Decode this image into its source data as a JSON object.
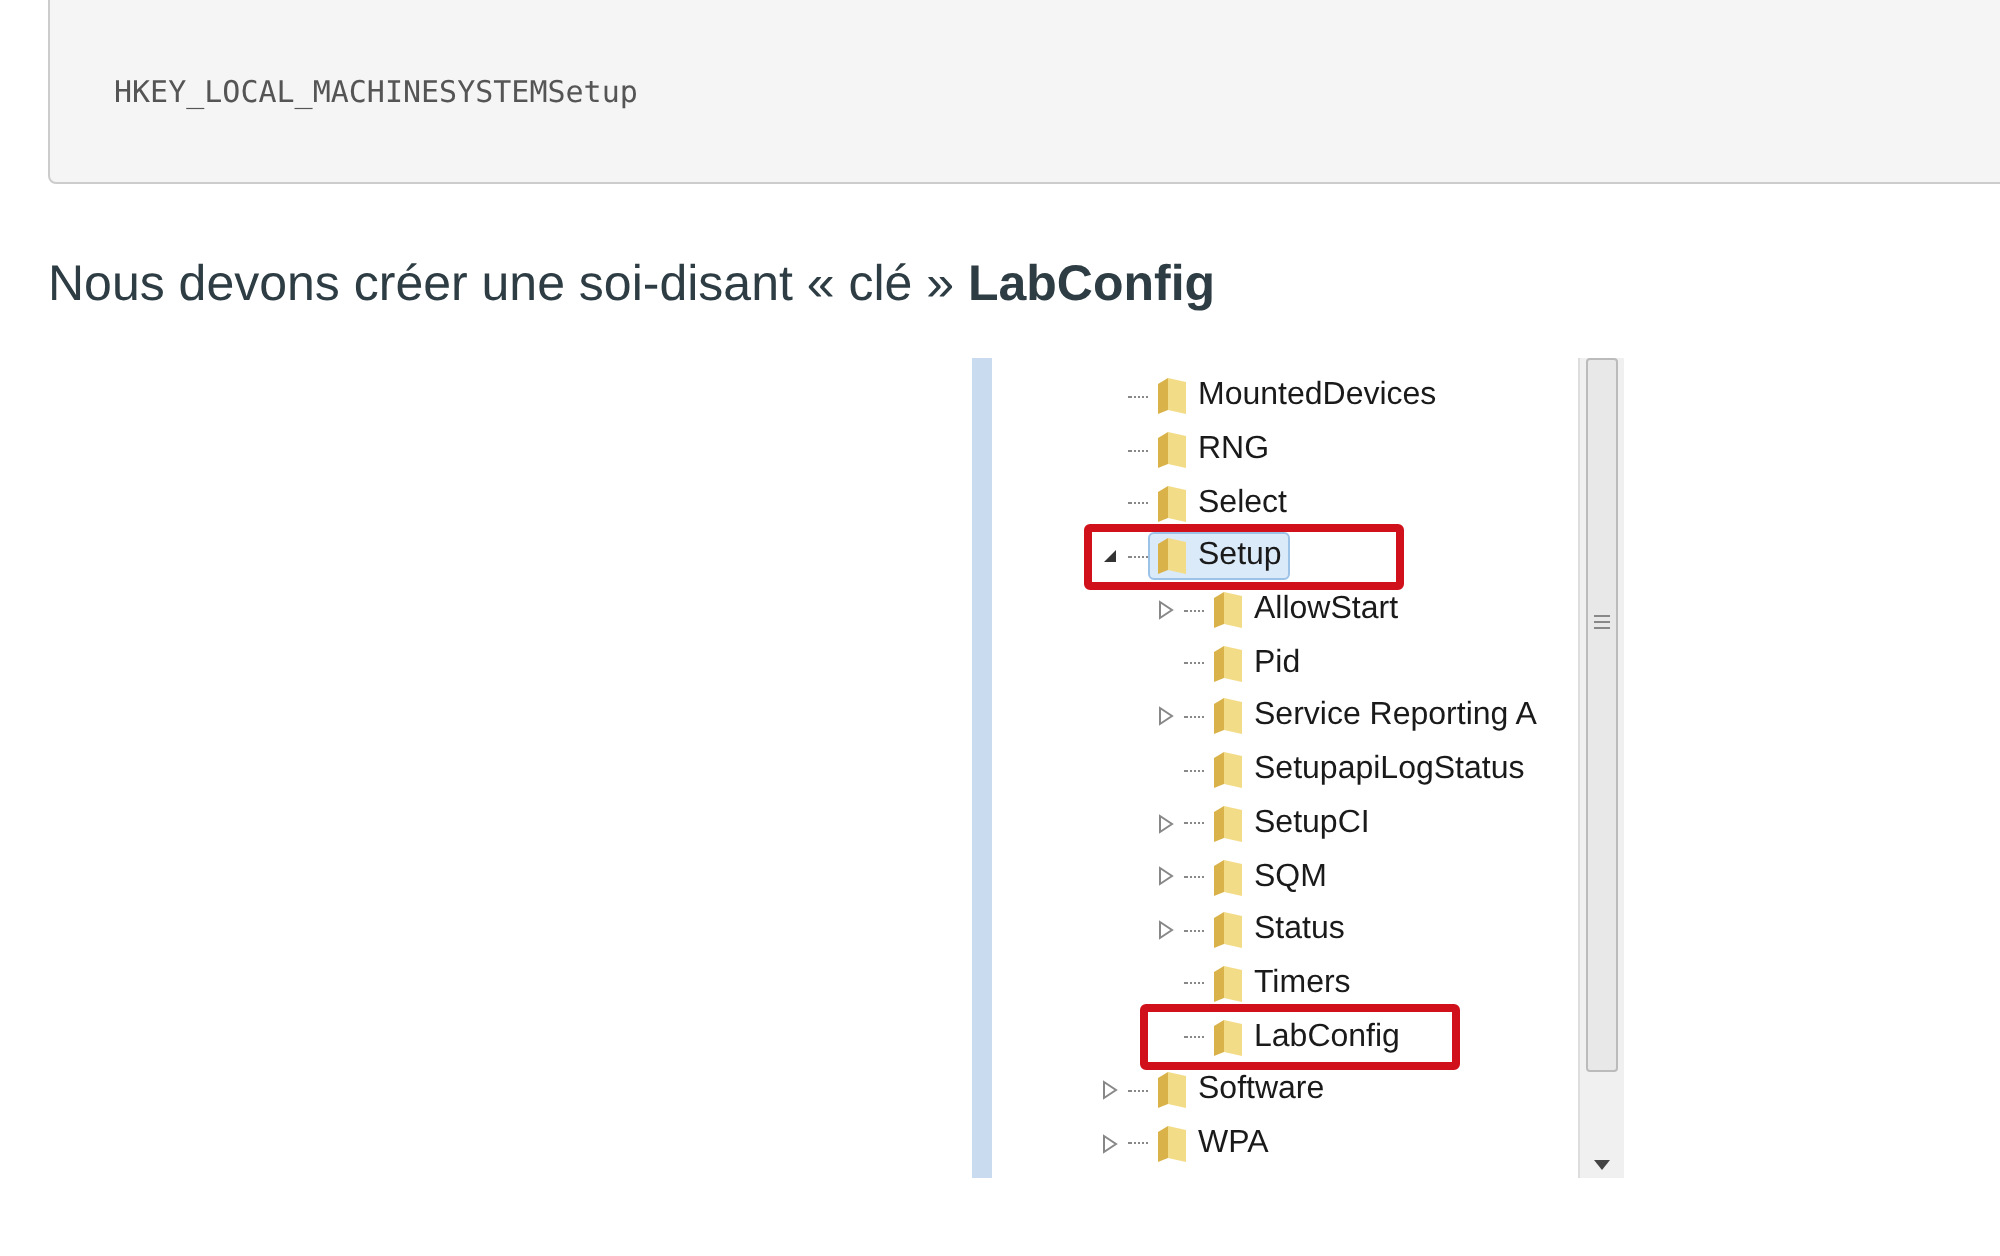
{
  "code_block": {
    "text": "HKEY_LOCAL_MACHINESYSTEMSetup"
  },
  "paragraph": {
    "text": "Nous devons créer une soi-disant « clé » **LabConfig**"
  },
  "registry_tree": {
    "items": [
      {
        "label": "MountedDevices",
        "selected": false,
        "highlighted": false
      },
      {
        "label": "RNG",
        "selected": false,
        "highlighted": false
      },
      {
        "label": "Select",
        "selected": false,
        "highlighted": false
      },
      {
        "label": "Setup",
        "expanded": true,
        "selected": true,
        "highlighted": true,
        "children": [
          {
            "label": "AllowStart",
            "expanded": false,
            "selected": false,
            "highlighted": false
          },
          {
            "label": "Pid",
            "selected": false,
            "highlighted": false
          },
          {
            "label": "Service Reporting A",
            "expanded": false,
            "selected": false,
            "highlighted": false
          },
          {
            "label": "SetupapiLogStatus",
            "selected": false,
            "highlighted": false
          },
          {
            "label": "SetupCI",
            "expanded": false,
            "selected": false,
            "highlighted": false
          },
          {
            "label": "SQM",
            "expanded": false,
            "selected": false,
            "highlighted": false
          },
          {
            "label": "Status",
            "expanded": false,
            "selected": false,
            "highlighted": false
          },
          {
            "label": "Timers",
            "selected": false,
            "highlighted": false
          },
          {
            "label": "LabConfig",
            "selected": false,
            "highlighted": true
          }
        ]
      },
      {
        "label": "Software",
        "expanded": false,
        "selected": false,
        "highlighted": false
      },
      {
        "label": "WPA",
        "expanded": false,
        "selected": false,
        "highlighted": false
      }
    ]
  }
}
